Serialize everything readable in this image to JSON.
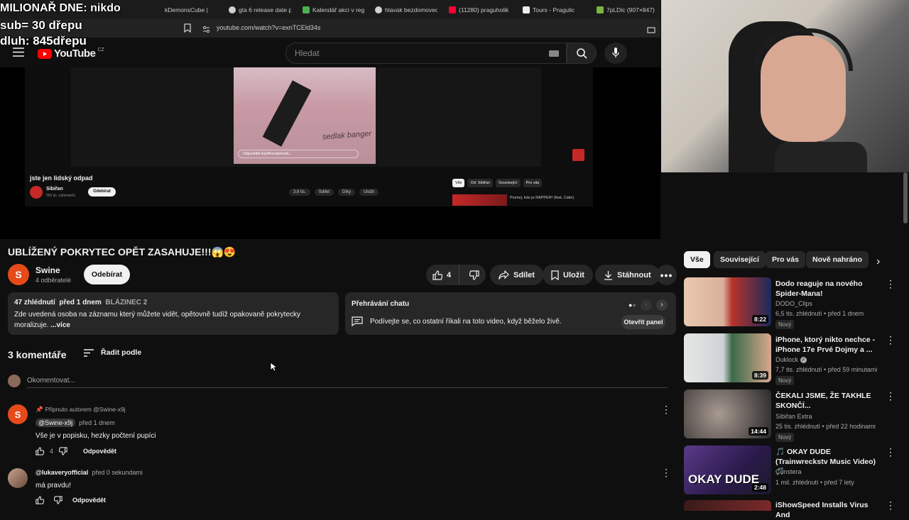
{
  "browser": {
    "tabs": [
      "kDemonsCube |",
      "gta 6 release date p",
      "Kalendář akcí v reg",
      "hlavak bezdomovec",
      "(11280) praguholik",
      "Tours - Pragulic",
      "7pLDic (907×847)"
    ],
    "url": "youtube.com/watch?v=exnTCEld34s"
  },
  "overlay": {
    "line1": "MILIONAŘ DNE: nikdo",
    "line2": "sub= 30 dřepu",
    "line3": "dluh: 845dřepu"
  },
  "header": {
    "logo": "YouTube",
    "logo_sup": "CZ",
    "search_placeholder": "Hledat"
  },
  "nested": {
    "title": "jste jen lidský odpad",
    "channel": "Sibiřan",
    "subs": "555 tis. odběratelů",
    "subscribe": "Odebírat",
    "likes": "3,6 tis.",
    "share": "Sdílet",
    "thanks": "Díky",
    "save": "Uložit",
    "chips": [
      "Vše",
      "Od: Sibiřan",
      "Související",
      "Pro vás"
    ],
    "rec_title": "Poznej, kdo je RAPPER! (feat. Calin)",
    "overlay_text": "sedlak banger",
    "comment_placeholder": "Odpovědět kopiříkovatelnosti..."
  },
  "video": {
    "title": "UBLÍŽENÝ POKRYTEC OPĚT ZASAHUJE!!!😱😍",
    "channel": "Swine",
    "channel_initial": "S",
    "subscribers": "4 odběratelé",
    "subscribe": "Odebírat",
    "likes": "4",
    "share": "Sdílet",
    "save": "Uložit",
    "download": "Stáhnout"
  },
  "description": {
    "views": "47 zhlédnutí",
    "date": "před 1 dnem",
    "tag": "BLÁZINEC 2",
    "text": "Zde uvedená osoba na záznamu který můžete vidět, opětovně tudíž opakovaně pokrytecky moralizuje.",
    "text_cut": "Zde uvedená osoba na záznamu který můžete vidět, opětovně tudíž opakovaně pokrytecky",
    "text_cut2": "moralizuje.",
    "more": "...více"
  },
  "chat": {
    "title": "Přehrávání chatu",
    "text": "Podívejte se, co ostatní říkali na toto video, když běželo živě.",
    "button": "Otevřít panel"
  },
  "comments": {
    "count": "3 komentáře",
    "sort": "Řadit podle",
    "placeholder": "Okomentovat...",
    "items": [
      {
        "pinned": "Připnuto autorem @Swine-x9j",
        "author": "@Swine-x9j",
        "time": "před 1 dnem",
        "text": "Vše je v popisku, hezky počtení pupíci",
        "likes": "4",
        "reply": "Odpovědět",
        "initial": "S"
      },
      {
        "author": "@lukaveryofficial",
        "time": "před 0 sekundami",
        "text": "má pravdu!",
        "reply": "Odpovědět"
      }
    ]
  },
  "related": {
    "chips": [
      "Vše",
      "Související",
      "Pro vás",
      "Nově nahráno"
    ],
    "items": [
      {
        "title": "Dodo reaguje na nového Spider-Mana!",
        "channel": "DODO_Clips",
        "meta": "6,5 tis. zhlédnutí • před 1 dnem",
        "badge": "Nový",
        "duration": "8:22",
        "color": "#b8332a"
      },
      {
        "title": "iPhone, ktorý nikto nechce - iPhone 17e Prvé Dojmy a ...",
        "channel": "Duklock",
        "meta": "7,7 tis. zhlédnutí • před 59 minutami",
        "badge": "Nový",
        "duration": "8:39",
        "color": "#3a6a4a"
      },
      {
        "title": "ČEKALI JSME, ŽE TAKHLE SKONČÍ...",
        "channel": "Sibiřan Extra",
        "meta": "25 tis. zhlédnutí • před 22 hodinami",
        "badge": "Nový",
        "duration": "14:44",
        "color": "#8a8a8a"
      },
      {
        "title": "🎵 OKAY DUDE (Trainwreckstv Music Video) 🎵",
        "channel": "Constera",
        "meta": "1 mil. zhlédnutí • před 7 lety",
        "badge": "",
        "duration": "2:48",
        "color": "#4a2a6a",
        "thumb_text": "OKAY DUDE"
      },
      {
        "title": "iShowSpeed Installs Virus And",
        "channel": "",
        "meta": "",
        "badge": "",
        "duration": "",
        "color": "#7a2a2a"
      }
    ]
  },
  "colors": {
    "background": "#0f0f0f",
    "chip": "#272727",
    "youtube_red": "#ff0000",
    "avatar": "#e64a19"
  }
}
